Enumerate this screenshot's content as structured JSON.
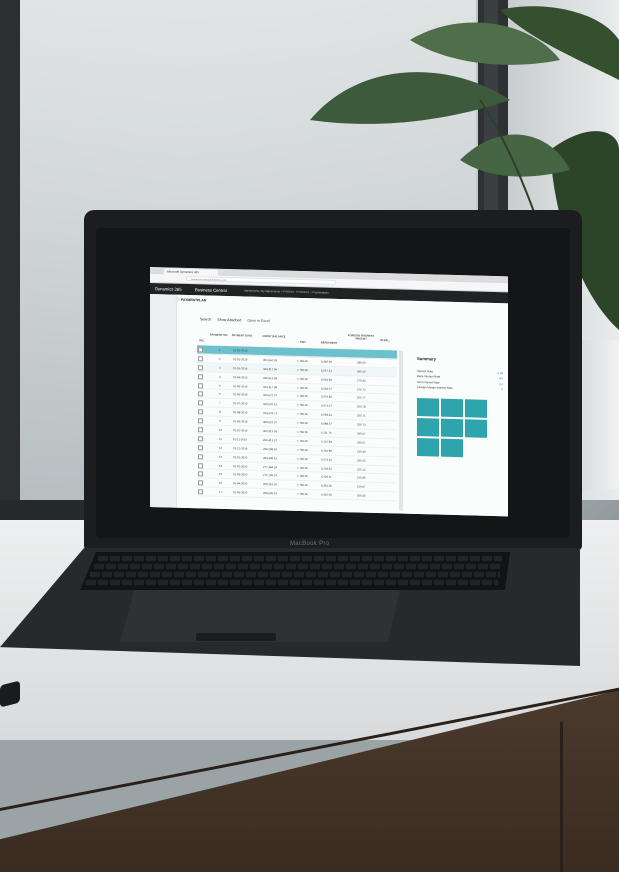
{
  "device": {
    "label": "MacBook Pro"
  },
  "browser": {
    "tab_title": "Microsoft Dynamics 365",
    "address": "businesscentral.dynamics.com"
  },
  "app": {
    "brand": "Dynamics 365",
    "product": "Business Central",
    "breadcrumb": "Agreements, My Agreements  >  FIN0001 · FT000001  >  Paymentplan"
  },
  "page": {
    "title": "PAYMENTPLAN",
    "actions": {
      "search": "Search",
      "show_attached": "Show Attached",
      "open_excel": "Open in Excel"
    }
  },
  "grid": {
    "headers": [
      "INC.",
      "PAYMENT NO.",
      "PAYMENT DATE",
      "FRONT BALANCE",
      "PMT",
      "REPAYMENT",
      "FOREIGN INTEREST AMOUNT",
      "IN BAL."
    ],
    "rows": [
      {
        "no": "1",
        "date": "01-01-2019",
        "balance": "",
        "pmt": "",
        "repayment": "",
        "interest": "",
        "selected": true
      },
      {
        "no": "2",
        "date": "01-02-2019",
        "balance": "356,962.09",
        "pmt": "7,750.00",
        "repayment": "5,440.96",
        "interest": "285.60"
      },
      {
        "no": "3",
        "date": "01-03-2019",
        "balance": "344,417.06",
        "pmt": "7,750.00",
        "repayment": "5,057.41",
        "interest": "280.15",
        "alt": true
      },
      {
        "no": "4",
        "date": "01-04-2019",
        "balance": "339,513.58",
        "pmt": "7,750.00",
        "repayment": "5,554.83",
        "interest": "275.83"
      },
      {
        "no": "5",
        "date": "01-05-2019",
        "balance": "333,317.08",
        "pmt": "7,750.00",
        "repayment": "5,544.07",
        "interest": "270.72"
      },
      {
        "no": "6",
        "date": "01-06-2019",
        "balance": "326,671.07",
        "pmt": "7,750.00",
        "repayment": "5,579.86",
        "interest": "265.77"
      },
      {
        "no": "7",
        "date": "01-07-2019",
        "balance": "320,691.51",
        "pmt": "7,750.00",
        "repayment": "6,073.07",
        "interest": "260.78"
      },
      {
        "no": "8",
        "date": "01-08-2019",
        "balance": "314,678.71",
        "pmt": "7,750.00",
        "repayment": "6,084.44",
        "interest": "255.71"
      },
      {
        "no": "9",
        "date": "01-09-2019",
        "balance": "308,623.07",
        "pmt": "7,750.00",
        "repayment": "6,088.97",
        "interest": "250.73"
      },
      {
        "no": "10",
        "date": "01-10-2019",
        "balance": "302,513.93",
        "pmt": "7,750.00",
        "repayment": "6,111.76",
        "interest": "245.67"
      },
      {
        "no": "11",
        "date": "01-11-2019",
        "balance": "296,413.57",
        "pmt": "7,750.00",
        "repayment": "6,197.84",
        "interest": "240.57"
      },
      {
        "no": "12",
        "date": "01-12-2019",
        "balance": "290,208.63",
        "pmt": "7,750.00",
        "repayment": "6,191.80",
        "interest": "235.40"
      },
      {
        "no": "13",
        "date": "01-01-2020",
        "balance": "283,908.61",
        "pmt": "7,750.00",
        "repayment": "6,274.12",
        "interest": "230.25"
      },
      {
        "no": "14",
        "date": "01-02-2020",
        "balance": "277,484.29",
        "pmt": "7,750.00",
        "repayment": "6,293.52",
        "interest": "225.12"
      },
      {
        "no": "15",
        "date": "01-03-2020",
        "balance": "271,143.07",
        "pmt": "7,750.00",
        "repayment": "6,329.11",
        "interest": "219.85"
      },
      {
        "no": "16",
        "date": "01-04-2020",
        "balance": "265,216.26",
        "pmt": "7,750.00",
        "repayment": "6,351.20",
        "interest": "214.67"
      },
      {
        "no": "17",
        "date": "01-05-2020",
        "balance": "258,939.16",
        "pmt": "7,750.00",
        "repayment": "6,415.05",
        "interest": "209.45"
      }
    ]
  },
  "summary": {
    "title": "Summary",
    "rows": [
      {
        "label": "Interest Rate",
        "value": "8.00"
      },
      {
        "label": "Base Interest Rate",
        "value": "8.0"
      },
      {
        "label": "Own Interest Rate",
        "value": "0.0"
      },
      {
        "label": "Foreign Margin Interest Rate",
        "value": "0"
      }
    ]
  },
  "colors": {
    "accent": "#2ea5ad",
    "selection": "#6cc1cc",
    "appbar": "#202324"
  }
}
